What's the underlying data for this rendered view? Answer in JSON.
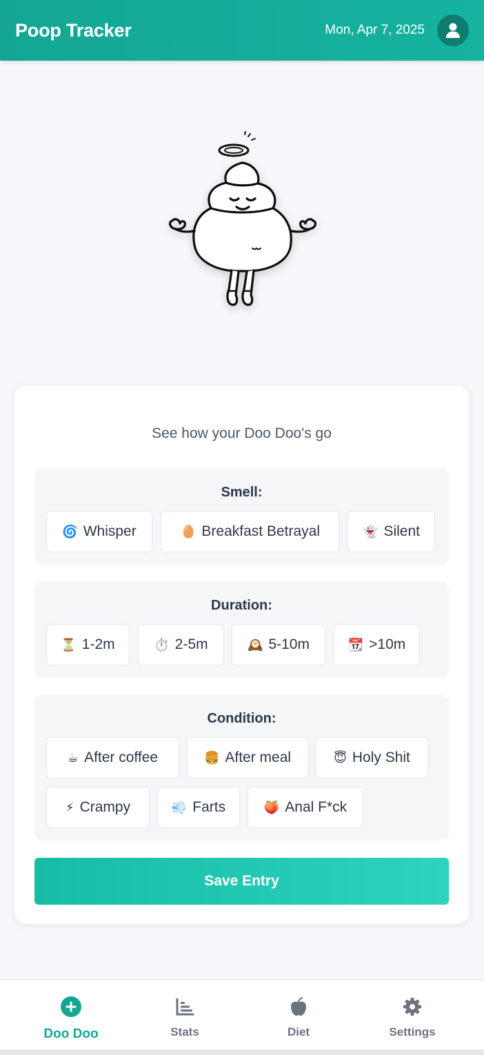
{
  "header": {
    "title": "Poop Tracker",
    "date": "Mon, Apr 7, 2025",
    "avatar_icon": "user-icon"
  },
  "mascot": {
    "icon": "poop-angel-mascot"
  },
  "card": {
    "subtitle": "See how your Doo Doo's go",
    "smell": {
      "title": "Smell:",
      "options": [
        {
          "emoji": "🌀",
          "label": "Whisper"
        },
        {
          "emoji": "🥚",
          "label": "Breakfast Betrayal"
        },
        {
          "emoji": "👻",
          "label": "Silent"
        }
      ]
    },
    "duration": {
      "title": "Duration:",
      "options": [
        {
          "emoji": "⏳",
          "label": "1-2m"
        },
        {
          "emoji": "⏱️",
          "label": "2-5m"
        },
        {
          "emoji": "🕰️",
          "label": "5-10m"
        },
        {
          "emoji": "📆",
          "label": ">10m"
        }
      ]
    },
    "condition": {
      "title": "Condition:",
      "options": [
        {
          "emoji": "☕",
          "label": "After coffee"
        },
        {
          "emoji": "🍔",
          "label": "After meal"
        },
        {
          "emoji": "😇",
          "label": "Holy Shit"
        },
        {
          "emoji": "⚡",
          "label": "Crampy"
        },
        {
          "emoji": "💨",
          "label": "Farts"
        },
        {
          "emoji": "🍑",
          "label": "Anal F*ck"
        }
      ]
    },
    "save_label": "Save Entry"
  },
  "nav": {
    "items": [
      {
        "label": "Doo Doo",
        "icon": "plus-circle-icon",
        "active": true
      },
      {
        "label": "Stats",
        "icon": "bar-chart-icon",
        "active": false
      },
      {
        "label": "Diet",
        "icon": "apple-icon",
        "active": false
      },
      {
        "label": "Settings",
        "icon": "gear-icon",
        "active": false
      }
    ]
  },
  "colors": {
    "brand": "#14a693",
    "accent": "#2ed3c0",
    "background": "#f5f7fa"
  }
}
